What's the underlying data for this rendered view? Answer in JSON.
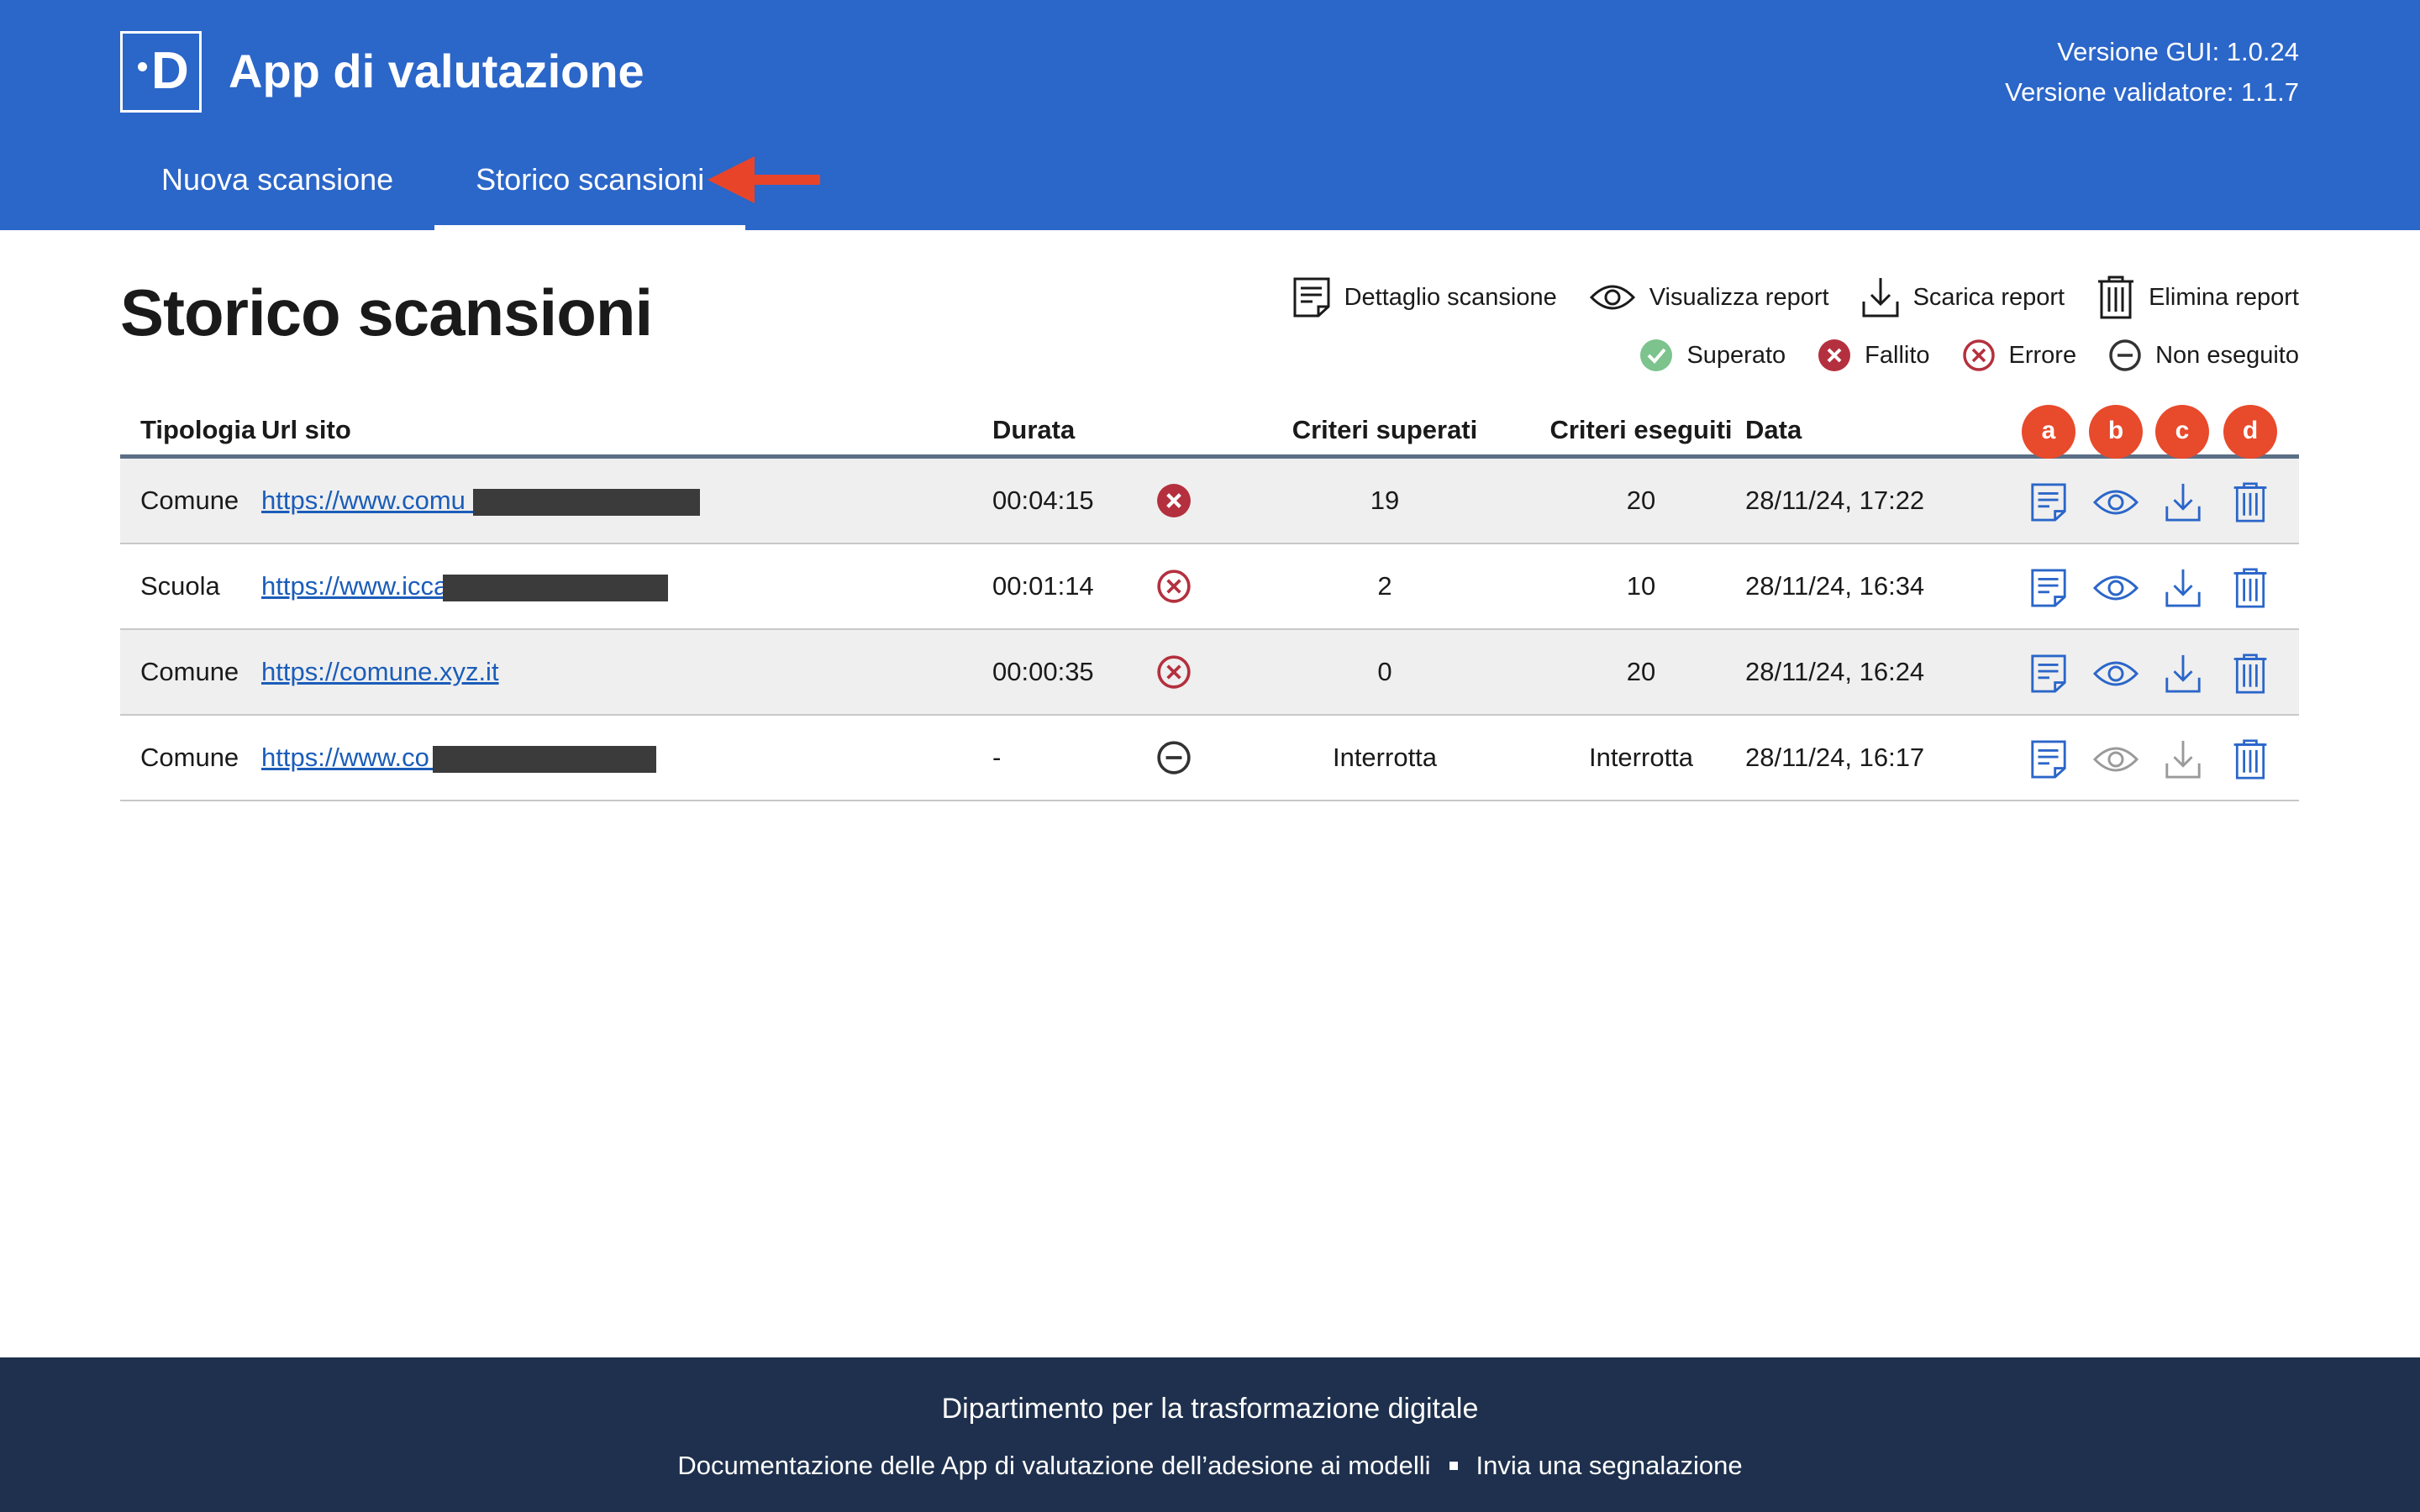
{
  "header": {
    "logo_letter": "D",
    "app_title": "App di valutazione",
    "version_gui": "Versione GUI: 1.0.24",
    "version_validator": "Versione validatore: 1.1.7",
    "tabs": [
      {
        "label": "Nuova scansione",
        "active": false
      },
      {
        "label": "Storico scansioni",
        "active": true
      }
    ],
    "accent_color": "#2b66c9"
  },
  "page": {
    "title": "Storico scansioni"
  },
  "legend": {
    "actions": [
      {
        "icon": "detail-icon",
        "label": "Dettaglio scansione"
      },
      {
        "icon": "eye-icon",
        "label": "Visualizza report"
      },
      {
        "icon": "download-icon",
        "label": "Scarica report"
      },
      {
        "icon": "trash-icon",
        "label": "Elimina report"
      }
    ],
    "statuses": [
      {
        "icon": "check-circle-icon",
        "label": "Superato",
        "color": "#7cc38d"
      },
      {
        "icon": "x-filled-circle-icon",
        "label": "Fallito",
        "color": "#b4303e"
      },
      {
        "icon": "x-outline-circle-icon",
        "label": "Errore",
        "color": "#b4303e"
      },
      {
        "icon": "minus-circle-icon",
        "label": "Non eseguito",
        "color": "#333333"
      }
    ]
  },
  "table": {
    "headers": {
      "tipologia": "Tipologia",
      "url": "Url sito",
      "durata": "Durata",
      "criteri_superati": "Criteri superati",
      "criteri_eseguiti": "Criteri eseguiti",
      "data": "Data"
    },
    "badges": [
      "a",
      "b",
      "c",
      "d"
    ],
    "rows": [
      {
        "tipologia": "Comune",
        "url": "https://www.comu                        it/",
        "durata": "00:04:15",
        "status": "fallito",
        "superati": "19",
        "eseguiti": "20",
        "data": "28/11/24, 17:22"
      },
      {
        "tipologia": "Scuola",
        "url": "https://www.icca                          .it/wp/",
        "durata": "00:01:14",
        "status": "errore",
        "superati": "2",
        "eseguiti": "10",
        "data": "28/11/24, 16:34"
      },
      {
        "tipologia": "Comune",
        "url": "https://comune.xyz.it",
        "durata": "00:00:35",
        "status": "errore",
        "superati": "0",
        "eseguiti": "20",
        "data": "28/11/24, 16:24"
      },
      {
        "tipologia": "Comune",
        "url": "https://www.co                         it/home.page",
        "durata": "-",
        "status": "non-eseguito",
        "superati": "Interrotta",
        "eseguiti": "Interrotta",
        "data": "28/11/24, 16:17"
      }
    ]
  },
  "footer": {
    "title": "Dipartimento per la trasformazione digitale",
    "link_docs": "Documentazione delle App di valutazione dell’adesione ai modelli",
    "link_report": "Invia una segnalazione"
  }
}
